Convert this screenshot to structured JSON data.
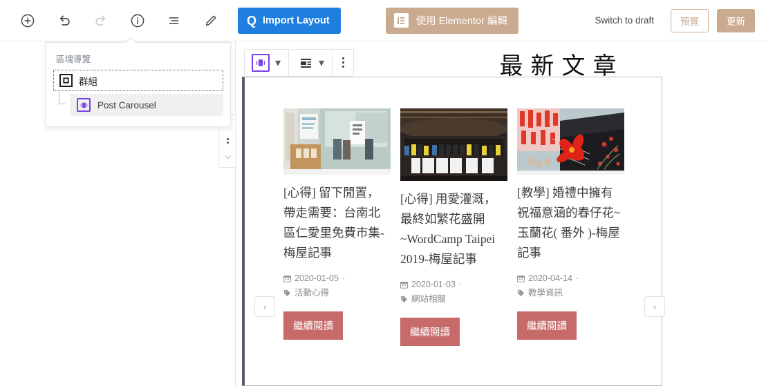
{
  "toolbar": {
    "add_block_label": "add-block",
    "undo_label": "undo",
    "redo_label": "redo",
    "info_label": "details",
    "list_view_label": "block-navigation",
    "edit_label": "edit",
    "import_layout_label": "Import Layout",
    "import_badge": "Q",
    "elementor_label": "使用 Elementor 編輯",
    "switch_to_draft": "Switch to draft",
    "preview_label": "預覽",
    "update_label": "更新",
    "accent_blue": "#1e7fe0",
    "accent_tan": "#cbab8f"
  },
  "popover": {
    "title": "區塊導覽",
    "items": [
      {
        "label": "群組",
        "icon": "group-icon",
        "selected": true
      },
      {
        "label": "Post Carousel",
        "icon": "carousel-icon",
        "selected": false
      }
    ]
  },
  "block_toolbar": {
    "block_icon": "post-carousel-icon",
    "block_caret": "▾",
    "align_icon": "align-left-icon",
    "align_caret": "▾",
    "more_label": "more-options"
  },
  "canvas": {
    "heading": "最新文章",
    "prev_label": "‹",
    "next_label": "›",
    "accent_button": "#c76a6a"
  },
  "carousel": {
    "read_more_label": "繼續閱讀",
    "cards": [
      {
        "title": "[心得] 留下閒置，帶走需要：台南北區仁愛里免費市集-梅屋記事",
        "date": "2020-01-05",
        "separator": "·",
        "category": "活動心得",
        "image_alt": "免費市集入口看板照片"
      },
      {
        "title": "[心得] 用愛灌溉，最終如繁花盛開~WordCamp Taipei 2019-梅屋記事",
        "date": "2020-01-03",
        "separator": "·",
        "category": "網站相關",
        "image_alt": "WordCamp Taipei 2019 大合照 #WCTPE"
      },
      {
        "title": "[教學] 婚禮中擁有祝福意涵的春仔花~玉蘭花( 番外 )-梅屋記事",
        "date": "2020-04-14",
        "separator": "·",
        "category": "教學資訊",
        "image_alt": "紅色春仔花手工花飾"
      }
    ]
  }
}
